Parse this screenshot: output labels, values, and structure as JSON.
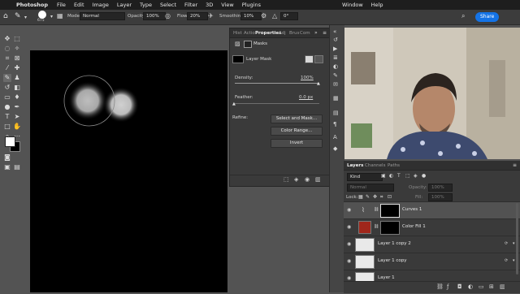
{
  "menubar": {
    "app": "Photoshop",
    "items": [
      "File",
      "Edit",
      "Image",
      "Layer",
      "Type",
      "Select",
      "Filter",
      "3D",
      "View",
      "Plugins",
      "Window",
      "Help"
    ]
  },
  "options": {
    "brush_size": "675",
    "mode_label": "Mode:",
    "mode_value": "Normal",
    "opacity_label": "Opacity:",
    "opacity_value": "100%",
    "flow_label": "Flow:",
    "flow_value": "20%",
    "smoothing_label": "Smoothing:",
    "smoothing_value": "10%",
    "angle_value": "0°",
    "share_label": "Share"
  },
  "properties": {
    "tabs": [
      "Hist",
      "Actio",
      "Properties",
      "Adj",
      "Brus",
      "Com"
    ],
    "section": "Masks",
    "mask_label": "Layer Mask",
    "density_label": "Density:",
    "density_value": "100%",
    "density": 1.0,
    "feather_label": "Feather:",
    "feather_value": "0.0 px",
    "feather": 0.0,
    "refine_label": "Refine:",
    "btn_select_mask": "Select and Mask...",
    "btn_color_range": "Color Range...",
    "btn_invert": "Invert"
  },
  "layers": {
    "tabs": [
      "Layers",
      "Channels",
      "Paths"
    ],
    "filter_kind": "Kind",
    "blend_mode": "Normal",
    "opacity_label": "Opacity:",
    "opacity_value": "100%",
    "lock_label": "Lock:",
    "fill_label": "Fill:",
    "fill_value": "100%",
    "rows": [
      {
        "name": "Curves 1"
      },
      {
        "name": "Color Fill 1"
      },
      {
        "name": "Layer 1 copy 2"
      },
      {
        "name": "Layer 1 copy"
      },
      {
        "name": "Layer 1"
      }
    ]
  },
  "colors": {
    "accent": "#1473e6",
    "color_fill_swatch": "#a0271b",
    "canvas": "#000000"
  }
}
